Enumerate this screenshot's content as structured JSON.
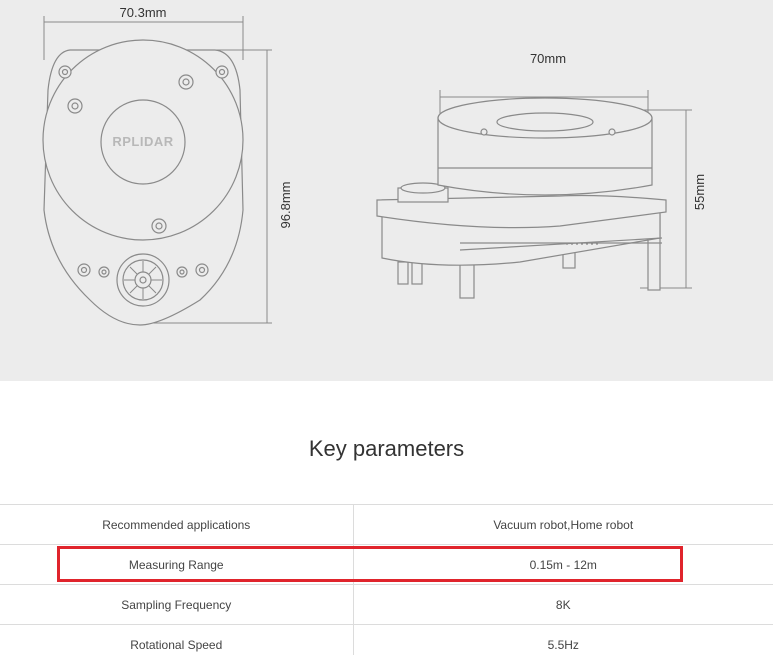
{
  "drawing": {
    "top_view_width_label": "70.3mm",
    "top_view_height_label": "96.8mm",
    "logo_text": "RPLIDAR",
    "side_view_width_label": "70mm",
    "side_view_height_label": "55mm"
  },
  "section_title": "Key parameters",
  "parameters": [
    {
      "name": "Recommended applications",
      "value": "Vacuum robot,Home robot"
    },
    {
      "name": "Measuring Range",
      "value": "0.15m - 12m"
    },
    {
      "name": "Sampling Frequency",
      "value": "8K"
    },
    {
      "name": "Rotational Speed",
      "value": "5.5Hz"
    }
  ],
  "highlight": {
    "row": "Measuring Range",
    "color": "#e0242c"
  },
  "colors": {
    "panel_bg": "#ececec",
    "line": "#8a8a8a",
    "text": "#333333"
  }
}
